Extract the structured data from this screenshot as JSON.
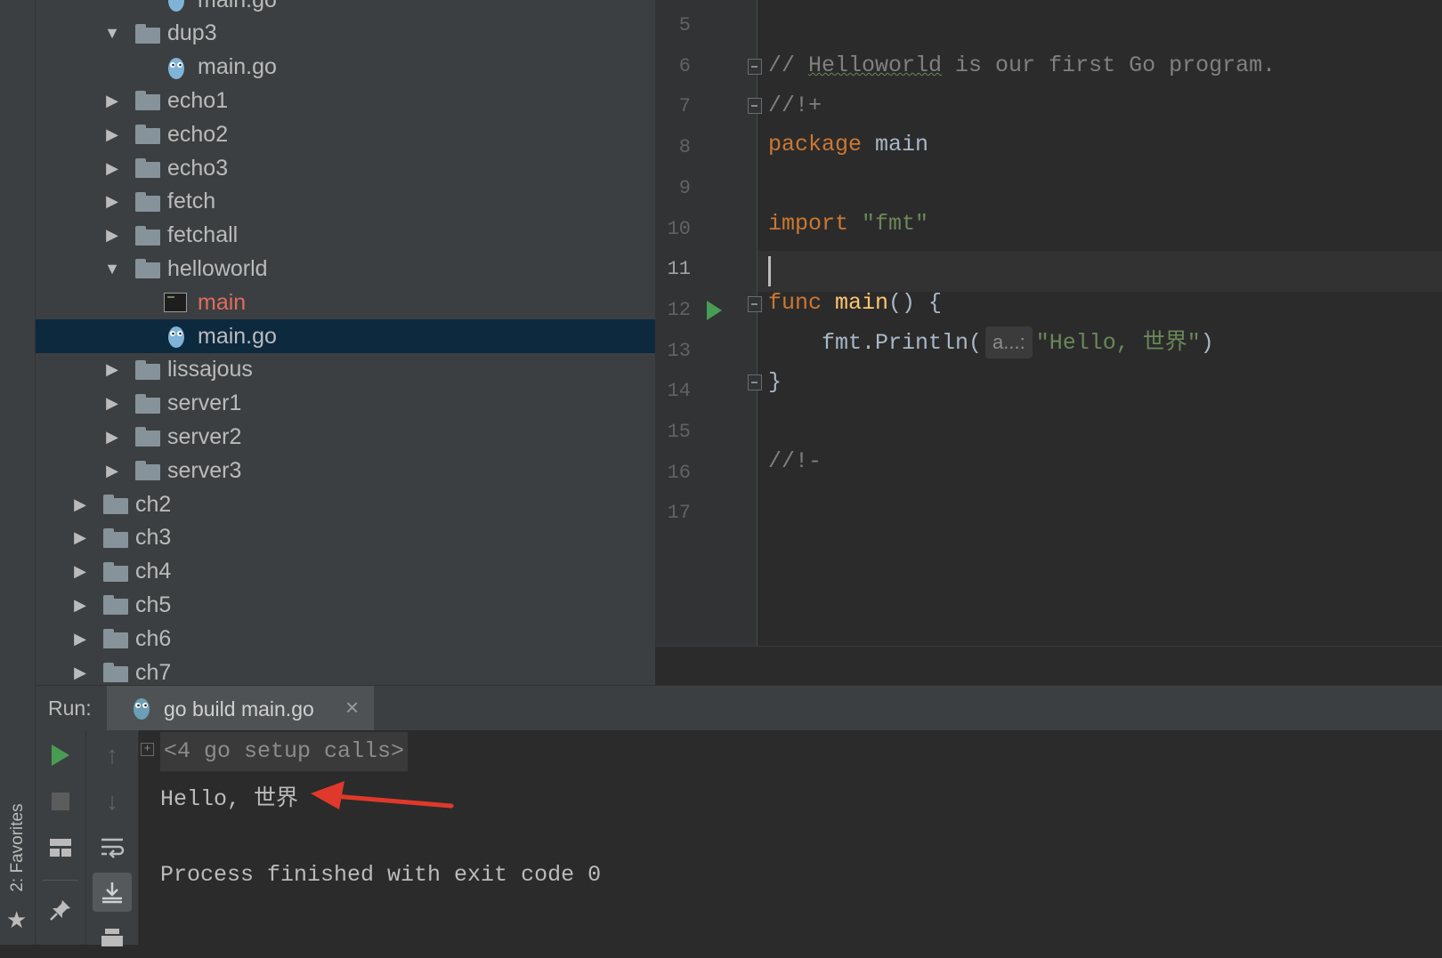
{
  "sidebar_strip": {
    "favorites_label": "2: Favorites",
    "favorites_icon": "star-icon"
  },
  "project_tree": {
    "items": [
      {
        "label": "main.go",
        "kind": "go-file",
        "depth": 4
      },
      {
        "label": "dup3",
        "kind": "folder",
        "expanded": true,
        "depth": 3
      },
      {
        "label": "main.go",
        "kind": "go-file",
        "depth": 4
      },
      {
        "label": "echo1",
        "kind": "folder",
        "expanded": false,
        "depth": 3
      },
      {
        "label": "echo2",
        "kind": "folder",
        "expanded": false,
        "depth": 3
      },
      {
        "label": "echo3",
        "kind": "folder",
        "expanded": false,
        "depth": 3
      },
      {
        "label": "fetch",
        "kind": "folder",
        "expanded": false,
        "depth": 3
      },
      {
        "label": "fetchall",
        "kind": "folder",
        "expanded": false,
        "depth": 3
      },
      {
        "label": "helloworld",
        "kind": "folder",
        "expanded": true,
        "depth": 3
      },
      {
        "label": "main",
        "kind": "executable",
        "depth": 4
      },
      {
        "label": "main.go",
        "kind": "go-file",
        "depth": 4,
        "selected": true
      },
      {
        "label": "lissajous",
        "kind": "folder",
        "expanded": false,
        "depth": 3
      },
      {
        "label": "server1",
        "kind": "folder",
        "expanded": false,
        "depth": 3
      },
      {
        "label": "server2",
        "kind": "folder",
        "expanded": false,
        "depth": 3
      },
      {
        "label": "server3",
        "kind": "folder",
        "expanded": false,
        "depth": 3
      },
      {
        "label": "ch2",
        "kind": "folder",
        "expanded": false,
        "depth": 2
      },
      {
        "label": "ch3",
        "kind": "folder",
        "expanded": false,
        "depth": 2
      },
      {
        "label": "ch4",
        "kind": "folder",
        "expanded": false,
        "depth": 2
      },
      {
        "label": "ch5",
        "kind": "folder",
        "expanded": false,
        "depth": 2
      },
      {
        "label": "ch6",
        "kind": "folder",
        "expanded": false,
        "depth": 2
      },
      {
        "label": "ch7",
        "kind": "folder",
        "expanded": false,
        "depth": 2
      }
    ]
  },
  "editor": {
    "line_numbers": [
      "5",
      "6",
      "7",
      "8",
      "9",
      "10",
      "11",
      "12",
      "13",
      "14",
      "15",
      "16",
      "17"
    ],
    "current_line": "11",
    "code": {
      "line6_comment_prefix": "// ",
      "line6_squiggle_word": "Helloworld",
      "line6_comment_rest": " is our first Go program.",
      "line7": "//!+",
      "line8_kw": "package",
      "line8_rest": " main",
      "line10_kw": "import",
      "line10_str": " \"fmt\"",
      "line12_kw": "func",
      "line12_fn": " main",
      "line12_rest": "() {",
      "line13_call": "    fmt.Println(",
      "line13_hint": "a...:",
      "line13_str": "\"Hello, 世界\"",
      "line13_end": ")",
      "line14": "}",
      "line16": "//!-"
    }
  },
  "run_panel": {
    "title": "Run:",
    "tab_label": "go build main.go",
    "tab_close": "×",
    "console": {
      "folded_text": "<4 go setup calls>",
      "fold_expand_glyph": "+",
      "output_line": "Hello, 世界",
      "exit_line": "Process finished with exit code 0"
    },
    "toolbar_icons": [
      "rerun-icon",
      "stop-icon",
      "layout-icon",
      "pin-icon",
      "up-arrow-icon",
      "down-arrow-icon",
      "soft-wrap-icon",
      "scroll-to-end-icon",
      "print-icon"
    ]
  },
  "colors": {
    "accent_run": "#499c54",
    "annotation_arrow": "#e0392b",
    "keyword": "#cc7832",
    "string": "#6a8759",
    "function": "#ffc66d",
    "selection": "#0d293e"
  }
}
